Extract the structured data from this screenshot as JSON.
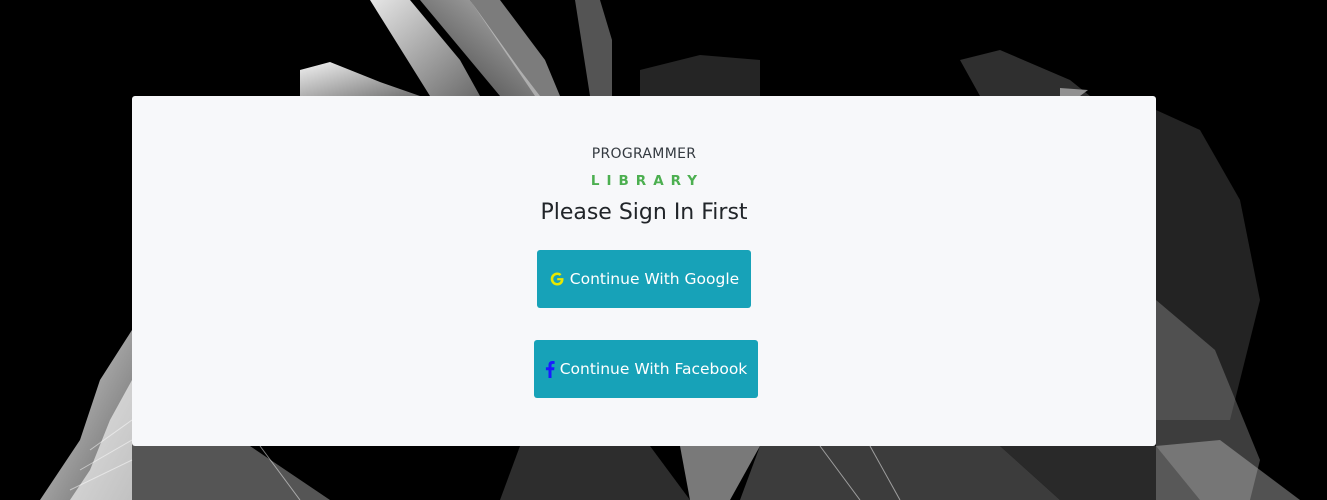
{
  "brand": {
    "name": "PROGRAMMER",
    "sub": "LIBRARY",
    "sub_color": "#4caf50"
  },
  "title": "Please Sign In First",
  "buttons": {
    "google": {
      "label": "Continue With Google",
      "icon": "google-icon",
      "icon_color": "#e8e800"
    },
    "facebook": {
      "label": "Continue With Facebook",
      "icon": "facebook-icon",
      "icon_color": "#1a1aff"
    }
  },
  "colors": {
    "button_bg": "#17a2b8",
    "card_bg": "#f7f8fa",
    "page_bg": "#000000"
  }
}
